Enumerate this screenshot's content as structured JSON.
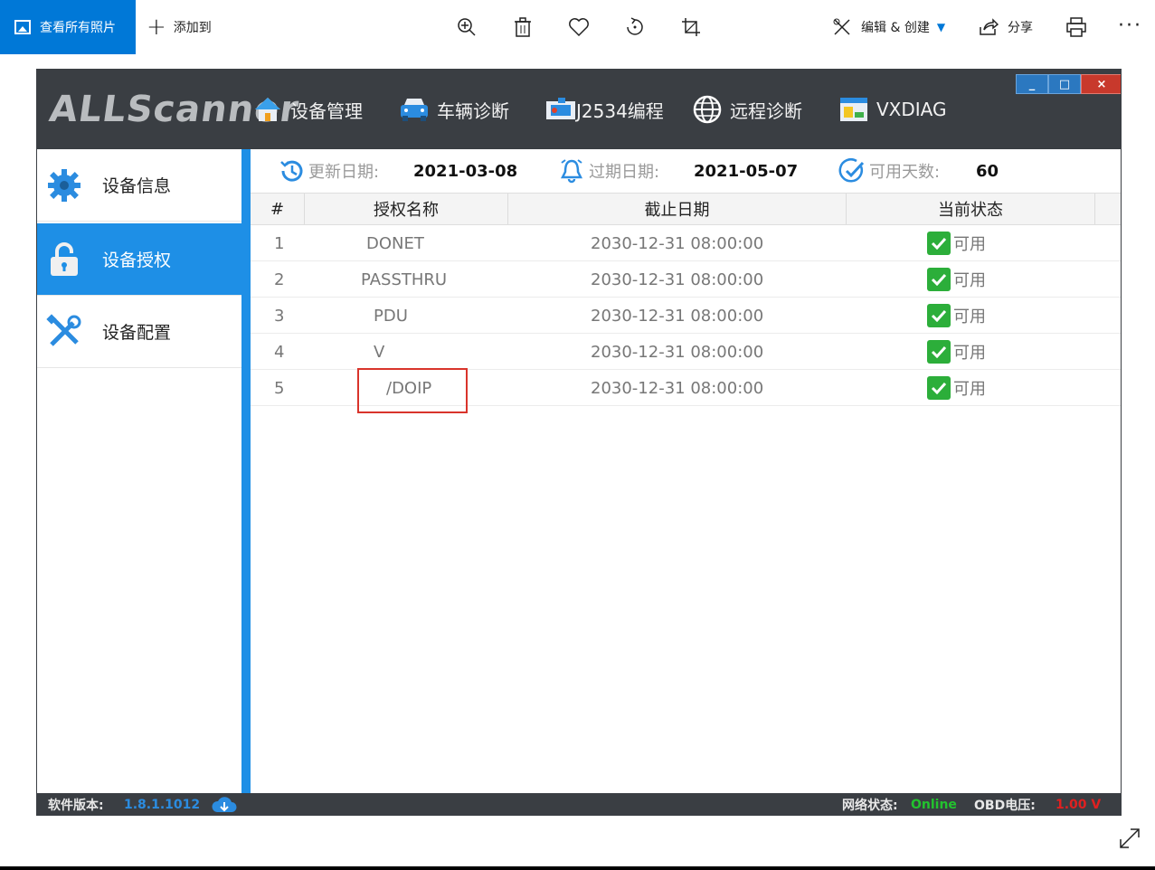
{
  "viewer": {
    "view_all_label": "查看所有照片",
    "add_to_label": "添加到",
    "edit_create_label": "编辑 & 创建",
    "share_label": "分享",
    "more_label": "···"
  },
  "app": {
    "logo_text": "ALLScanner",
    "nav": [
      {
        "label": "设备管理",
        "icon": "home-icon"
      },
      {
        "label": "车辆诊断",
        "icon": "car-icon"
      },
      {
        "label": "J2534编程",
        "icon": "engine-icon"
      },
      {
        "label": "远程诊断",
        "icon": "globe-icon"
      },
      {
        "label": "VXDIAG",
        "icon": "vxdiag-icon"
      }
    ],
    "window_buttons": {
      "minimize": "_",
      "maximize": "□",
      "close": "×"
    },
    "sidebar": [
      {
        "label": "设备信息",
        "icon": "gear-icon",
        "active": false
      },
      {
        "label": "设备授权",
        "icon": "lock-icon",
        "active": true
      },
      {
        "label": "设备配置",
        "icon": "tools-icon",
        "active": false
      }
    ],
    "info": {
      "update_label": "更新日期:",
      "update_value": "2021-03-08",
      "expire_label": "过期日期:",
      "expire_value": "2021-05-07",
      "days_label": "可用天数:",
      "days_value": "60"
    },
    "table": {
      "headers": [
        "#",
        "授权名称",
        "截止日期",
        "当前状态"
      ],
      "rows": [
        {
          "num": "1",
          "name": "DONET",
          "date": "2030-12-31 08:00:00",
          "status": "可用"
        },
        {
          "num": "2",
          "name": "PASSTHRU",
          "date": "2030-12-31 08:00:00",
          "status": "可用"
        },
        {
          "num": "3",
          "name": "PDU",
          "date": "2030-12-31 08:00:00",
          "status": "可用"
        },
        {
          "num": "4",
          "name": "V",
          "date": "2030-12-31 08:00:00",
          "status": "可用"
        },
        {
          "num": "5",
          "name": "/DOIP",
          "date": "2030-12-31 08:00:00",
          "status": "可用"
        }
      ]
    },
    "footer": {
      "version_label": "软件版本:",
      "version_value": "1.8.1.1012",
      "network_label": "网络状态:",
      "network_value": "Online",
      "obd_label": "OBD电压:",
      "obd_value": "1.00 V"
    },
    "colors": {
      "accent": "#1e8fe6",
      "header_bg": "#3a3e43",
      "status_green": "#2cae3a",
      "online_green": "#22c32e",
      "obd_red": "#e02020",
      "version_blue": "#2b8ce0",
      "highlight_red": "#d9342b"
    }
  }
}
